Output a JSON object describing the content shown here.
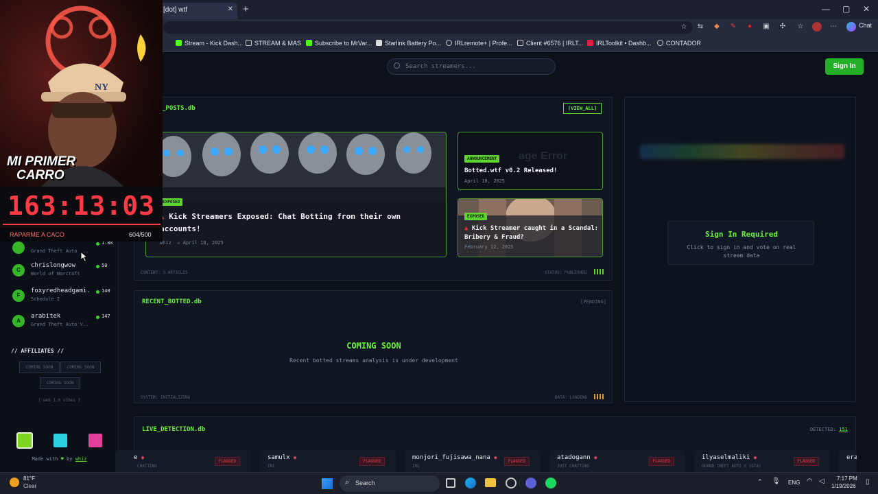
{
  "browser": {
    "tab_title": "[dot] wtf",
    "tab_close": "✕",
    "new_tab": "+",
    "window_controls": [
      "—",
      "▢",
      "✕"
    ],
    "chat_label": "Chat",
    "bookmarks": [
      "Stream - Kick Dash...",
      "STREAM & MAS",
      "Subscribe to MrVar...",
      "Starlink Battery Po...",
      "IRLremote+ | Profe...",
      "Client #6576 | IRLT...",
      "IRLToolkit • Dashb...",
      "CONTADOR"
    ]
  },
  "header": {
    "search_placeholder": "Search streamers...",
    "sign_in_label": "Sign In"
  },
  "sidebar": {
    "streamers": [
      {
        "name": "",
        "game": "Grand Theft Auto ...",
        "count": "1.8k",
        "initial": ""
      },
      {
        "name": "chrislongwow",
        "game": "World of Warcraft",
        "count": "50",
        "initial": "C"
      },
      {
        "name": "foxyredheadgami...",
        "game": "Schedule I",
        "count": "140",
        "initial": "F"
      },
      {
        "name": "arabitek",
        "game": "Grand Theft Auto V...",
        "count": "147",
        "initial": "A"
      }
    ],
    "affiliates_title": "// AFFILIATES //",
    "affiliate_slots": [
      "COMING SOON",
      "COMING SOON",
      "COMING SOON"
    ],
    "affiliate_note": "[ web 1.0 vibes ]",
    "swatch_colors": [
      "#7ed321",
      "#2bd4e0",
      "#e0409a"
    ],
    "made_with": "Made with",
    "by_label": "by",
    "author": "whiz"
  },
  "posts": {
    "title": "_POSTS.db",
    "view_all": "[VIEW_ALL]",
    "main": {
      "tag": "EXPOSED",
      "title": "Kick Streamers Exposed: Chat Botting from their own accounts!",
      "author": "whiz",
      "date": "April 18, 2025"
    },
    "side": [
      {
        "tag": "ANNOUNCEMENT",
        "title": "Botted.wtf v0.2 Released!",
        "date": "April 18, 2025",
        "bg_text": "age Error"
      },
      {
        "tag": "EXPOSED",
        "title": "Kick Streamer caught in a Scandal: Bribery & Fraud?",
        "date": "February 12, 2025"
      }
    ],
    "footer_left": "CONTENT: 3 ARTICLES",
    "footer_right": "STATUS: PUBLISHED"
  },
  "recent": {
    "title": "RECENT_BOTTED.db",
    "pending": "[PENDING]",
    "coming_soon": "COMING SOON",
    "subtitle": "Recent botted streams analysis is under development",
    "footer_left": "SYSTEM: INITIALIZING",
    "footer_right": "DATA: LOADING"
  },
  "right_panel": {
    "title": "Sign In Required",
    "desc_line1": "Click to sign in and vote on real",
    "desc_line2": "stream data"
  },
  "live": {
    "title": "LIVE_DETECTION.db",
    "detected_label": "DETECTED:",
    "detected_count": "151",
    "items": [
      {
        "name": "e",
        "game": "CHATTING",
        "flag": "FLAGGED"
      },
      {
        "name": "samulx",
        "game": "IRL",
        "flag": "FLAGGED"
      },
      {
        "name": "monjori_fujisawa_nana",
        "game": "IRL",
        "flag": "FLAGGED"
      },
      {
        "name": "atadogann",
        "game": "JUST CHATTING",
        "flag": "FLAGGED"
      },
      {
        "name": "ilyaselmaliki",
        "game": "GRAND THEFT AUTO V (GTA)",
        "flag": "FLAGGED"
      },
      {
        "name": "era",
        "game": "",
        "flag": ""
      }
    ]
  },
  "overlay": {
    "cap_text": "NY",
    "title_line1": "MI PRIMER",
    "title_line2": "CARRO",
    "timer": "163:13:03",
    "goal_label": "RAPARME A CACO",
    "goal_progress": "604/500"
  },
  "taskbar": {
    "weather_temp": "81°F",
    "weather_desc": "Clear",
    "search_label": "Search",
    "lang": "ENG",
    "time": "7:17 PM",
    "date": "1/19/2026"
  }
}
